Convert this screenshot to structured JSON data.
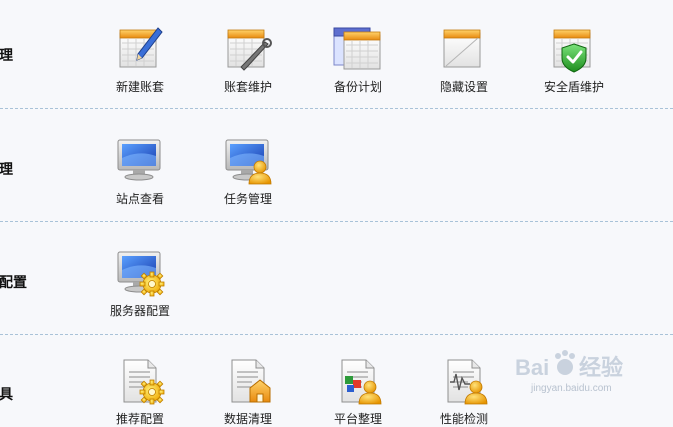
{
  "sections": [
    {
      "label": "理",
      "items": [
        {
          "label": "新建账套",
          "icon": "calendar-pen-icon"
        },
        {
          "label": "账套维护",
          "icon": "calendar-wrench-icon"
        },
        {
          "label": "备份计划",
          "icon": "calendars-icon"
        },
        {
          "label": "隐藏设置",
          "icon": "blank-calendar-icon"
        },
        {
          "label": "安全盾维护",
          "icon": "calendar-shield-icon"
        }
      ]
    },
    {
      "label": "理",
      "items": [
        {
          "label": "站点查看",
          "icon": "monitor-icon"
        },
        {
          "label": "任务管理",
          "icon": "monitor-user-icon"
        }
      ]
    },
    {
      "label": "配置",
      "items": [
        {
          "label": "服务器配置",
          "icon": "monitor-gear-icon"
        }
      ]
    },
    {
      "label": "具",
      "items": [
        {
          "label": "推荐配置",
          "icon": "document-gear-icon"
        },
        {
          "label": "数据清理",
          "icon": "document-home-icon"
        },
        {
          "label": "平台整理",
          "icon": "cubes-user-icon"
        },
        {
          "label": "性能检测",
          "icon": "chart-user-icon"
        }
      ]
    }
  ],
  "watermark": {
    "brand": "Bai",
    "brand2": "经验",
    "url": "jingyan.baidu.com"
  }
}
